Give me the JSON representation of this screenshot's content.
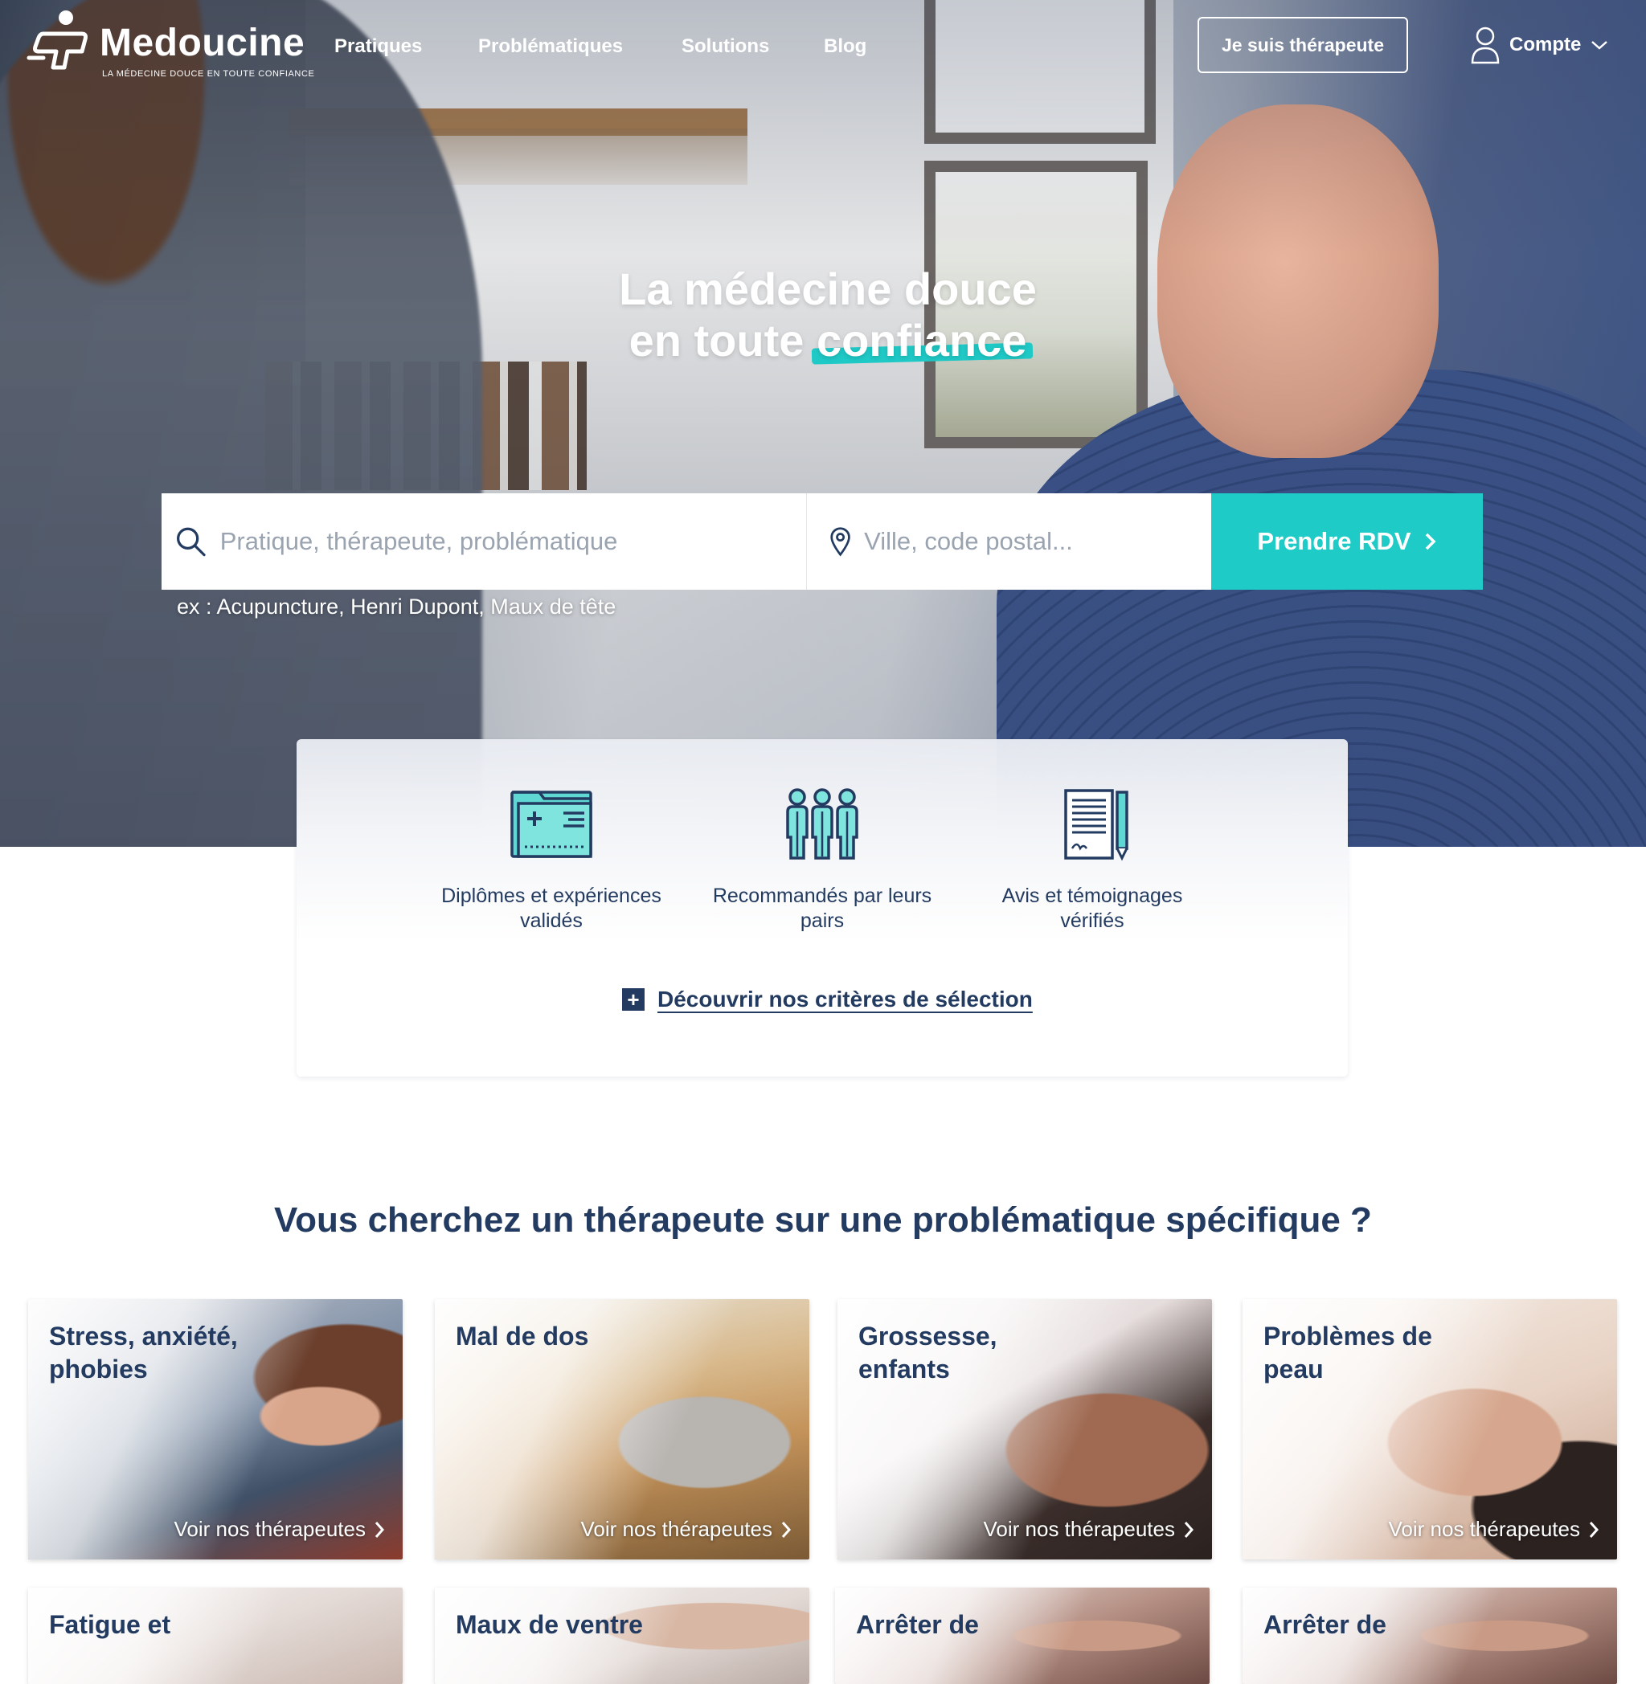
{
  "brand": {
    "name": "Medoucine",
    "tagline": "LA MÉDECINE DOUCE EN TOUTE CONFIANCE"
  },
  "nav": {
    "items": [
      {
        "label": "Pratiques"
      },
      {
        "label": "Problématiques"
      },
      {
        "label": "Solutions"
      },
      {
        "label": "Blog"
      }
    ],
    "therapist_button": "Je suis thérapeute",
    "account_label": "Compte"
  },
  "hero": {
    "title_line1": "La médecine douce",
    "title_line2_prefix": "en toute ",
    "title_line2_highlight": "confiance"
  },
  "search": {
    "what_placeholder": "Pratique, thérapeute, problématique",
    "where_placeholder": "Ville, code postal...",
    "submit_label": "Prendre RDV",
    "hint": "ex : Acupuncture, Henri Dupont, Maux de tête"
  },
  "trust": {
    "items": [
      {
        "icon": "certificate-folder-icon",
        "label_line1": "Diplômes et expériences",
        "label_line2": "validés"
      },
      {
        "icon": "peer-group-icon",
        "label_line1": "Recommandés par leurs",
        "label_line2": "pairs"
      },
      {
        "icon": "reviews-document-icon",
        "label_line1": "Avis et témoignages",
        "label_line2": "vérifiés"
      }
    ],
    "link_label": "Découvrir nos critères de sélection"
  },
  "section": {
    "title": "Vous cherchez un thérapeute sur une problématique spécifique ?"
  },
  "cards": [
    {
      "title_line1": "Stress, anxiété,",
      "title_line2": "phobies",
      "link": "Voir nos thérapeutes"
    },
    {
      "title_line1": "Mal de dos",
      "title_line2": "",
      "link": "Voir nos thérapeutes"
    },
    {
      "title_line1": "Grossesse,",
      "title_line2": "enfants",
      "link": "Voir nos thérapeutes"
    },
    {
      "title_line1": "Problèmes de",
      "title_line2": "peau",
      "link": "Voir nos thérapeutes"
    },
    {
      "title_line1": "Fatigue et",
      "title_line2": ""
    },
    {
      "title_line1": "Maux de ventre",
      "title_line2": ""
    },
    {
      "title_line1": "Arrêter de",
      "title_line2": ""
    },
    {
      "title_line1": "Arrêter de",
      "title_line2": ""
    }
  ],
  "colors": {
    "primary": "#233b60",
    "accent": "#1fcbc6"
  }
}
